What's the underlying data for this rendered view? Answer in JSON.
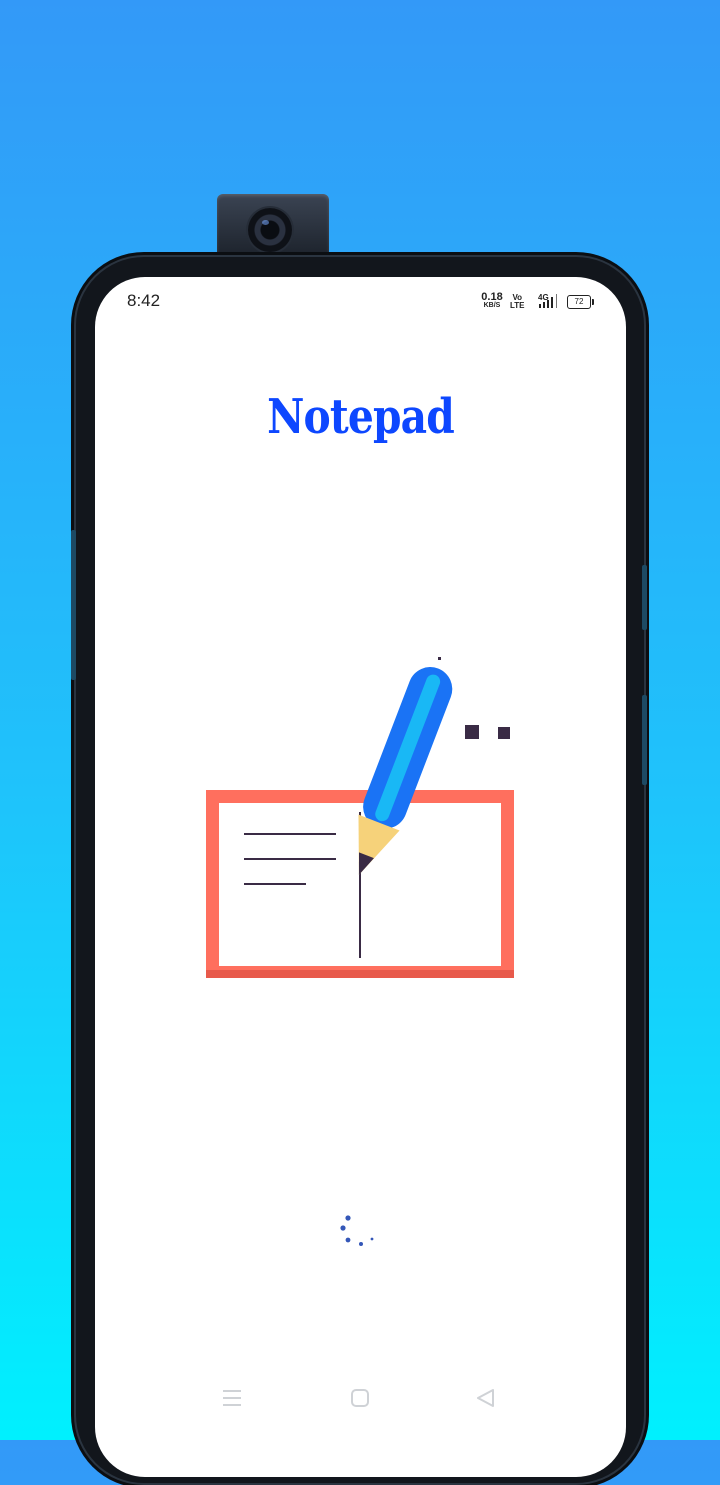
{
  "status_bar": {
    "time": "8:42",
    "net_speed_value": "0.18",
    "net_speed_unit": "KB/S",
    "volte_top": "Vo",
    "volte_bottom": "LTE",
    "network_type": "4G",
    "battery_level": "72"
  },
  "app": {
    "title": "Notepad"
  },
  "icons": {
    "menu": "menu-icon",
    "home": "home-square-icon",
    "back": "back-triangle-icon",
    "signal": "signal-bars-icon",
    "battery": "battery-icon",
    "spinner": "loading-spinner-icon"
  },
  "colors": {
    "title": "#0d47ff",
    "pencil": "#1a73f5",
    "board": "#ff6f5e",
    "line": "#3a2b45"
  }
}
